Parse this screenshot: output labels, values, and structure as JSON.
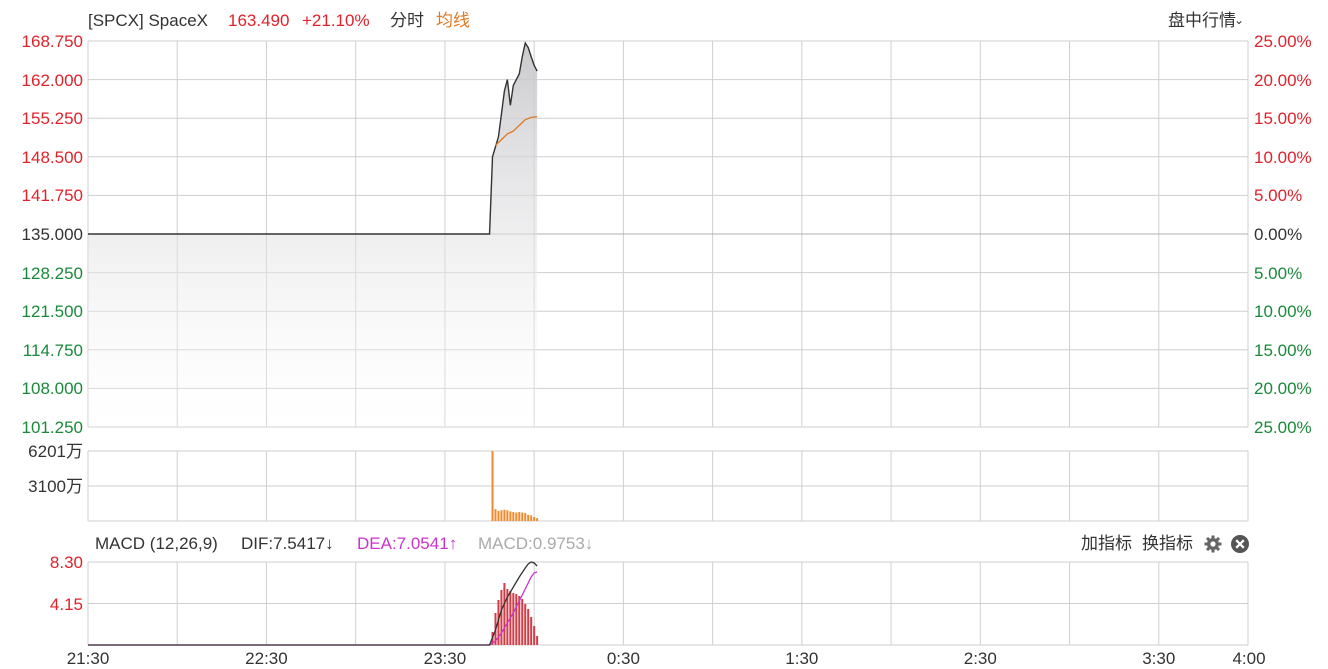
{
  "header": {
    "symbol": "[SPCX] SpaceX",
    "price": "163.490",
    "change": "+21.10%",
    "tab_fenshi": "分时",
    "tab_junxian": "均线",
    "mode_label": "盘中行情",
    "mode_chevron": "⌄"
  },
  "colors": {
    "up": "#e0222b",
    "down": "#1a8a3a",
    "avg_line": "#e07820",
    "price_line": "#333333",
    "volume": "#f08a30",
    "dea_line": "#cc33cc",
    "macd_bar": "#d23c46",
    "grid": "#cfcfcf"
  },
  "chart_data": [
    {
      "type": "line",
      "name": "price",
      "x_ticks": [
        "21:30",
        "22:30",
        "23:30",
        "0:30",
        "1:30",
        "2:30",
        "3:30",
        "4:00"
      ],
      "x_range_minutes": [
        0,
        390
      ],
      "price_ticks": [
        "168.750",
        "162.000",
        "155.250",
        "148.500",
        "141.750",
        "135.000",
        "128.250",
        "121.500",
        "114.750",
        "108.000",
        "101.250"
      ],
      "percent_ticks": [
        "25.00%",
        "20.00%",
        "15.00%",
        "10.00%",
        "5.00%",
        "0.00%",
        "5.00%",
        "10.00%",
        "15.00%",
        "20.00%",
        "25.00%"
      ],
      "ylim": [
        101.25,
        168.75
      ],
      "prev_close": 135.0,
      "price_series": [
        [
          0,
          135.0
        ],
        [
          135,
          135.0
        ],
        [
          136,
          148.5
        ],
        [
          138,
          152.0
        ],
        [
          139,
          156.0
        ],
        [
          140,
          160.0
        ],
        [
          141,
          162.0
        ],
        [
          142,
          157.5
        ],
        [
          143,
          161.0
        ],
        [
          145,
          163.0
        ],
        [
          146,
          166.0
        ],
        [
          147,
          168.4
        ],
        [
          148,
          167.6
        ],
        [
          149,
          166.0
        ],
        [
          150,
          164.5
        ],
        [
          151,
          163.5
        ]
      ],
      "avg_series": [
        [
          137,
          150.5
        ],
        [
          139,
          151.5
        ],
        [
          141,
          152.5
        ],
        [
          143,
          153.0
        ],
        [
          145,
          154.0
        ],
        [
          147,
          155.0
        ],
        [
          149,
          155.4
        ],
        [
          151,
          155.5
        ]
      ]
    },
    {
      "type": "bar",
      "name": "volume",
      "y_ticks": [
        "6201万",
        "3100万"
      ],
      "ylim": [
        0,
        6201
      ],
      "bars": [
        [
          136,
          6201
        ],
        [
          137,
          1050
        ],
        [
          138,
          900
        ],
        [
          139,
          950
        ],
        [
          140,
          1000
        ],
        [
          141,
          950
        ],
        [
          142,
          850
        ],
        [
          143,
          800
        ],
        [
          144,
          750
        ],
        [
          145,
          800
        ],
        [
          146,
          750
        ],
        [
          147,
          700
        ],
        [
          148,
          550
        ],
        [
          149,
          500
        ],
        [
          150,
          350
        ],
        [
          151,
          250
        ]
      ]
    },
    {
      "type": "bar",
      "name": "macd",
      "title": "MACD (12,26,9)",
      "dif_label": "DIF:7.5417",
      "dif_arrow": "↓",
      "dea_label": "DEA:7.0541",
      "dea_arrow": "↑",
      "macd_label": "MACD:0.9753",
      "macd_arrow": "↓",
      "add_label": "加指标",
      "swap_label": "换指标",
      "y_ticks": [
        "8.30",
        "4.15"
      ],
      "ylim": [
        0,
        8.3
      ],
      "dif_series": [
        [
          0,
          0.0
        ],
        [
          135,
          0.0
        ],
        [
          137,
          1.5
        ],
        [
          139,
          3.5
        ],
        [
          141,
          4.8
        ],
        [
          143,
          5.8
        ],
        [
          145,
          6.8
        ],
        [
          147,
          7.7
        ],
        [
          148,
          8.1
        ],
        [
          149,
          8.3
        ],
        [
          150,
          8.2
        ],
        [
          151,
          7.9
        ]
      ],
      "dea_series": [
        [
          0,
          0.0
        ],
        [
          135,
          0.0
        ],
        [
          137,
          0.4
        ],
        [
          139,
          1.2
        ],
        [
          141,
          2.2
        ],
        [
          143,
          3.2
        ],
        [
          145,
          4.4
        ],
        [
          147,
          5.6
        ],
        [
          149,
          6.8
        ],
        [
          150,
          7.2
        ],
        [
          151,
          7.3
        ]
      ],
      "macd_bars": [
        [
          136,
          1.3
        ],
        [
          137,
          3.2
        ],
        [
          138,
          4.5
        ],
        [
          139,
          5.5
        ],
        [
          140,
          6.2
        ],
        [
          141,
          5.6
        ],
        [
          142,
          5.4
        ],
        [
          143,
          5.2
        ],
        [
          144,
          5.1
        ],
        [
          145,
          4.9
        ],
        [
          146,
          4.6
        ],
        [
          147,
          4.1
        ],
        [
          148,
          3.6
        ],
        [
          149,
          2.8
        ],
        [
          150,
          1.9
        ],
        [
          151,
          0.9
        ]
      ]
    }
  ]
}
